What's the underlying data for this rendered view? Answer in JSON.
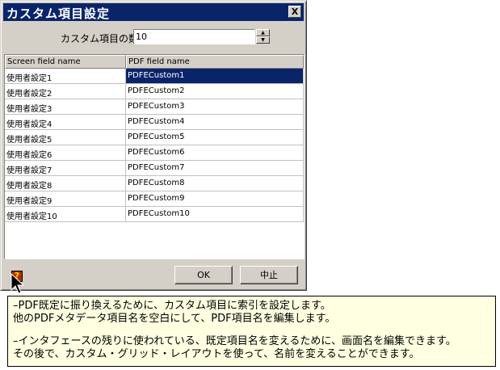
{
  "window": {
    "title": "カスタム項目設定",
    "close_label": "X"
  },
  "count": {
    "label": "カスタム項目の数",
    "value": "10"
  },
  "grid": {
    "columns": [
      "Screen field name",
      "PDF field name"
    ],
    "rows": [
      [
        "使用者設定1",
        "PDFECustom1"
      ],
      [
        "使用者設定2",
        "PDFECustom2"
      ],
      [
        "使用者設定3",
        "PDFECustom3"
      ],
      [
        "使用者設定4",
        "PDFECustom4"
      ],
      [
        "使用者設定5",
        "PDFECustom5"
      ],
      [
        "使用者設定6",
        "PDFECustom6"
      ],
      [
        "使用者設定7",
        "PDFECustom7"
      ],
      [
        "使用者設定8",
        "PDFECustom8"
      ],
      [
        "使用者設定9",
        "PDFECustom9"
      ],
      [
        "使用者設定10",
        "PDFECustom10"
      ]
    ],
    "selected_row": 0
  },
  "buttons": {
    "ok": "OK",
    "cancel": "中止"
  },
  "tooltip": {
    "line1": "–PDF既定に振り換えるために、カスタム項目に索引を設定します。",
    "line2": "他のPDFメタデータ項目名を空白にして、PDF項目名を編集します。",
    "line3": "–インタフェースの残りに使われている、既定項目名を変えるために、画面名を編集できます。",
    "line4": "その後で、カスタム・グリッド・レイアウトを使って、名前を変えることができます。"
  },
  "colors": {
    "selection": "#0a246a",
    "tooltip_bg": "#ffffe1",
    "dialog_bg": "#d4d0c8"
  },
  "icons": {
    "help": "help-question-icon",
    "pointer": "mouse-pointer-icon"
  }
}
